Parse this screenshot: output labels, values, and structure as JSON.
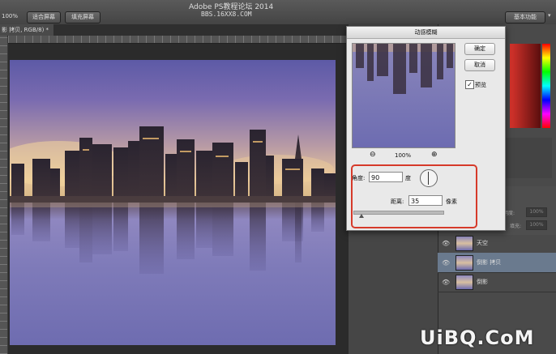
{
  "app": {
    "title": "Adobe PS教程论坛 2014",
    "subtitle": "BBS.16XX8.COM",
    "workspace": "基本功能"
  },
  "options_bar": {
    "zoom": "100%",
    "fit_screen": "适合屏幕",
    "fill_screen": "填充屏幕"
  },
  "document_tab": {
    "label": "影 拷贝, RGB/8) *"
  },
  "dialog": {
    "title": "动感模糊",
    "ok": "确定",
    "cancel": "取消",
    "preview_label": "预览",
    "preview_checked": true,
    "zoom": "100%",
    "zoom_out_icon": "zoom-out-icon",
    "zoom_in_icon": "zoom-in-icon",
    "angle_label": "角度:",
    "angle_value": "90",
    "angle_unit": "度",
    "distance_label": "距离:",
    "distance_value": "35",
    "distance_unit": "像素",
    "distance_slider_fraction": 0.08
  },
  "layers_panel": {
    "opacity_label": "不透明度:",
    "opacity_value": "100%",
    "fill_label": "填充:",
    "fill_value": "100%",
    "layers": [
      {
        "name": "天空",
        "visible": true,
        "selected": false
      },
      {
        "name": "倒影 拷贝",
        "visible": true,
        "selected": true
      },
      {
        "name": "倒影",
        "visible": true,
        "selected": false
      }
    ]
  },
  "watermark": "UiBQ.CoM",
  "colors": {
    "highlight_box": "#d63a2a",
    "selected_layer": "#6a7a8e"
  }
}
